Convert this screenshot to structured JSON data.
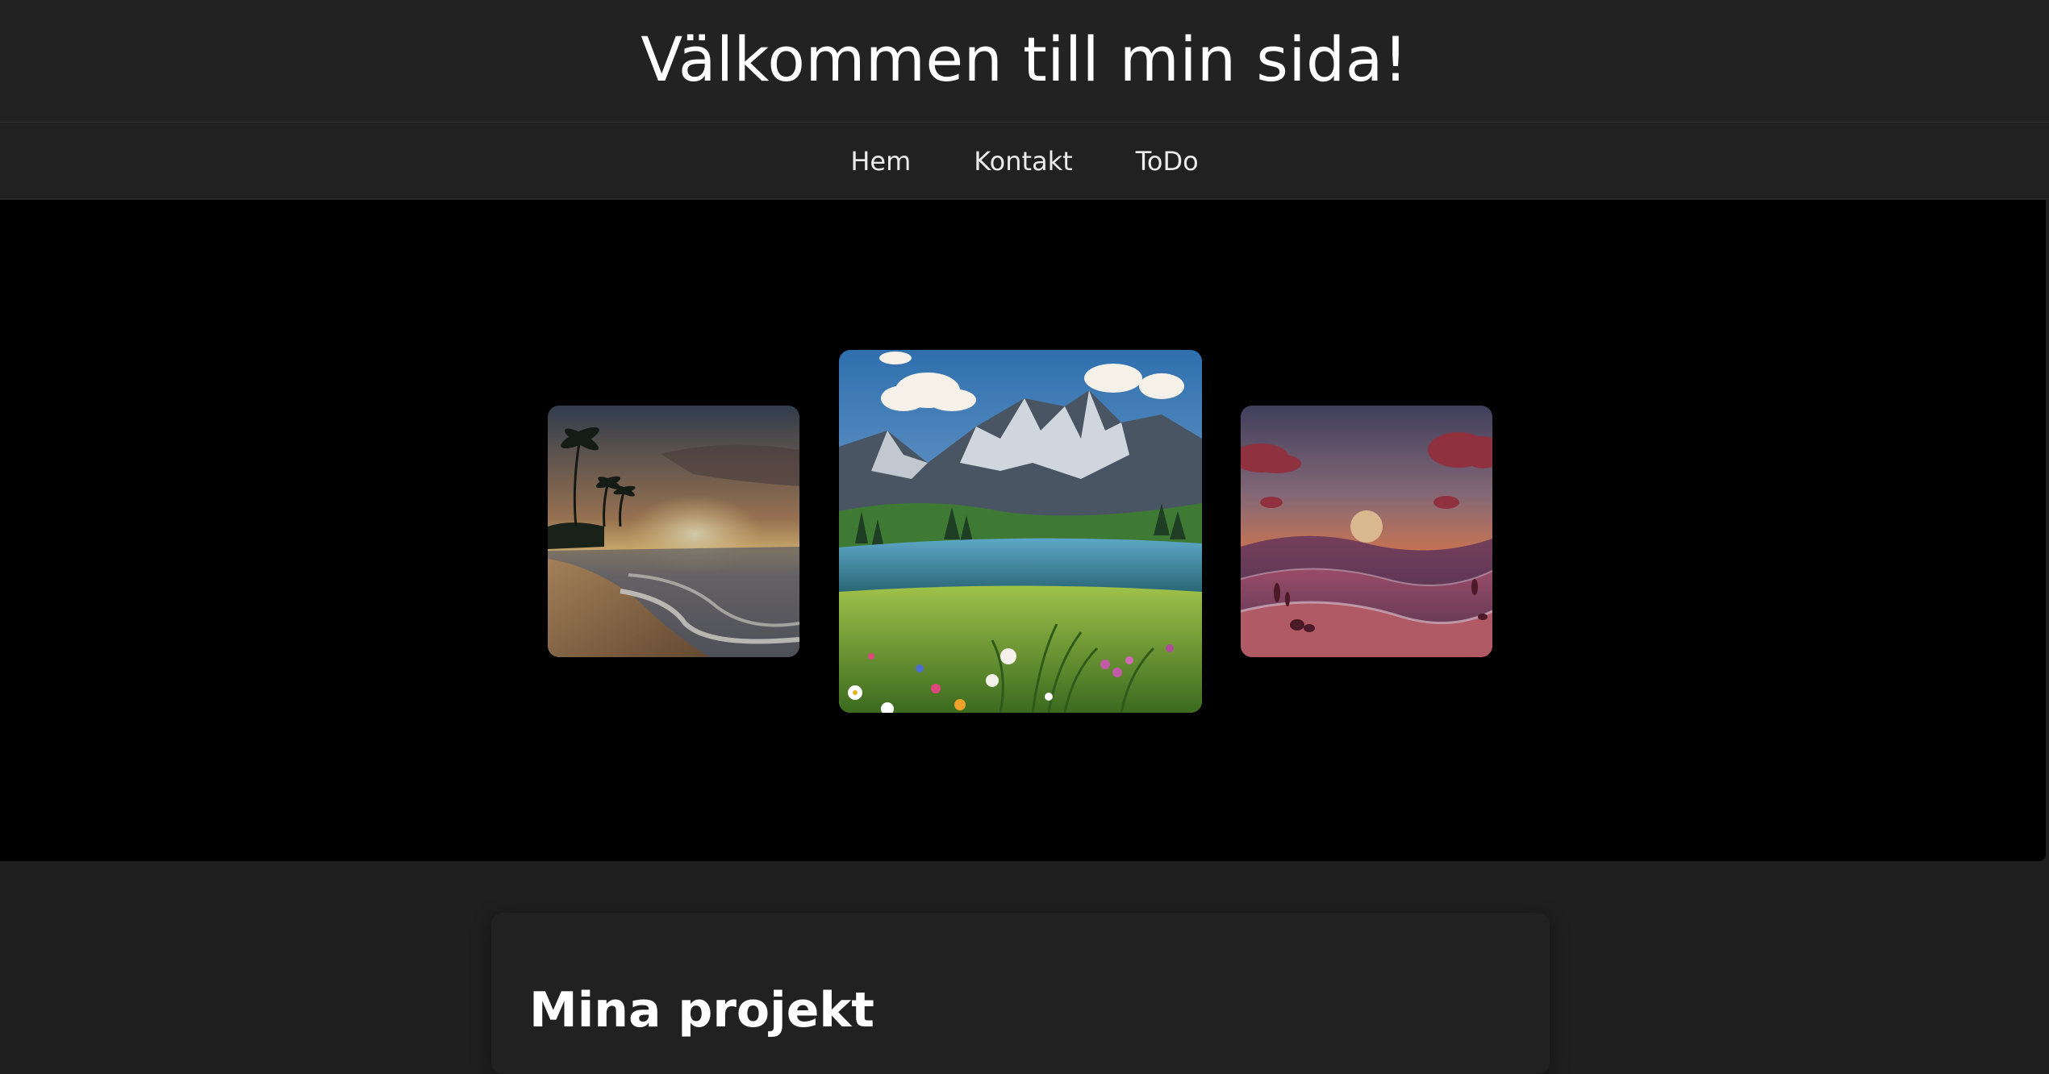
{
  "header": {
    "title": "Välkommen till min sida!"
  },
  "nav": {
    "items": [
      {
        "label": "Hem"
      },
      {
        "label": "Kontakt"
      },
      {
        "label": "ToDo"
      }
    ]
  },
  "carousel": {
    "slides": [
      {
        "name": "beach-sunset-image"
      },
      {
        "name": "mountain-lake-image"
      },
      {
        "name": "dunes-sunset-image"
      }
    ]
  },
  "projects": {
    "title": "Mina projekt"
  },
  "colors": {
    "page_bg": "#1f1f1f",
    "header_bg": "#222222",
    "carousel_bg": "#000000",
    "text": "#ffffff"
  }
}
